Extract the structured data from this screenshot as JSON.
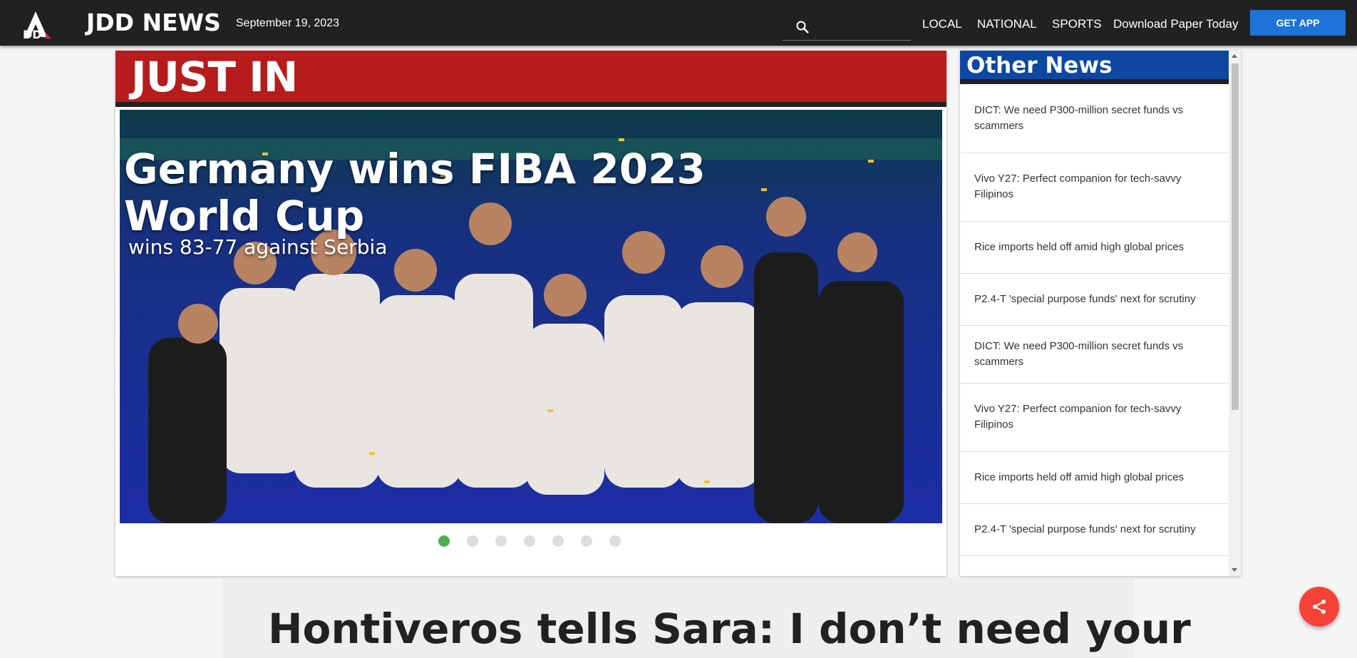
{
  "header": {
    "brand": "JDD NEWS",
    "logo_icon": "jdd-logo-icon",
    "date": "September 19, 2023",
    "search_placeholder": "",
    "nav": [
      "LOCAL",
      "NATIONAL",
      "SPORTS",
      "Download Paper Today"
    ],
    "get_app": "GET APP"
  },
  "just_in": {
    "heading": "JUST IN",
    "slide": {
      "headline": "Germany wins FIBA 2023 World Cup",
      "subheadline": "wins 83-77 against Serbia"
    },
    "slide_count": 7,
    "active_slide": 1
  },
  "other_news": {
    "heading": "Other News",
    "items": [
      "DICT: We need P300-million secret funds vs scammers",
      "Vivo Y27: Perfect companion for tech-savvy Filipinos",
      "Rice imports held off amid high global prices",
      "P2.4-T 'special purpose funds' next for scrutiny",
      "DICT: We need P300-million secret funds vs scammers",
      "Vivo Y27: Perfect companion for tech-savvy Filipinos",
      "Rice imports held off amid high global prices",
      "P2.4-T 'special purpose funds' next for scrutiny"
    ]
  },
  "article": {
    "title": "Hontiveros tells Sara: I don’t need your"
  },
  "colors": {
    "topbar": "#212121",
    "just_in": "#b71c1c",
    "other_news": "#0d47a1",
    "get_app": "#1e73d8",
    "active_dot": "#4caf50",
    "share": "#f44336"
  }
}
